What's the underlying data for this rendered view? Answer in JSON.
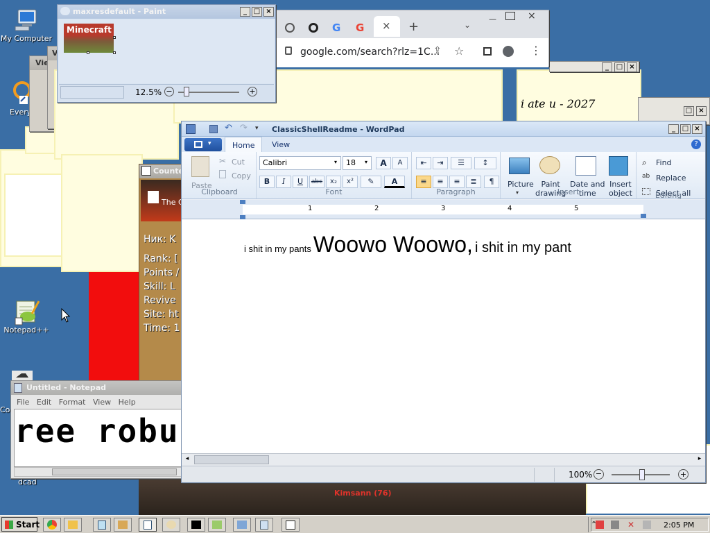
{
  "desktop": {
    "icons": [
      {
        "label": "My Computer"
      },
      {
        "label": "Every"
      },
      {
        "label": "Notepad++"
      },
      {
        "label": "Co"
      },
      {
        "label": "dcad"
      }
    ]
  },
  "paint": {
    "title": "maxresdefault - Paint",
    "image_text": "Minecraft",
    "zoom": "12.5%"
  },
  "chrome": {
    "url": "google.com/search?rlz=1C..."
  },
  "ghost_text": "i ate u - 2027",
  "counter": {
    "title": "Counte",
    "banner_text": "The C",
    "lines": [
      "Ник: K",
      "Rank: [",
      "Points /",
      "Skill: L",
      "Revive",
      "Site: ht",
      "Time: 1"
    ]
  },
  "game_text": "Kimsann (76)",
  "notepad": {
    "title": "Untitled - Notepad",
    "menu": [
      "File",
      "Edit",
      "Format",
      "View",
      "Help"
    ],
    "content": "ree robu"
  },
  "wordpad": {
    "title": "ClassicShellReadme - WordPad",
    "tabs": {
      "home": "Home",
      "view": "View"
    },
    "clipboard": {
      "paste": "Paste",
      "cut": "Cut",
      "copy": "Copy",
      "label": "Clipboard"
    },
    "font": {
      "family": "Calibri",
      "size": "18",
      "label": "Font",
      "bold": "B",
      "italic": "I",
      "underline": "U",
      "strike": "abc",
      "subscript": "x₂",
      "superscript": "x²",
      "grow": "A",
      "shrink": "A",
      "color": "A"
    },
    "paragraph": {
      "label": "Paragraph"
    },
    "insert": {
      "picture": "Picture",
      "paint_drawing": [
        "Paint",
        "drawing"
      ],
      "date_time": [
        "Date and",
        "time"
      ],
      "insert_object": [
        "Insert",
        "object"
      ],
      "label": "Insert"
    },
    "editing": {
      "find": "Find",
      "replace": "Replace",
      "select_all": "Select all",
      "label": "Editing"
    },
    "ruler_numbers": [
      "1",
      "2",
      "3",
      "4",
      "5"
    ],
    "doc": {
      "small1": "i shit in my pants",
      "big": "Woowo Woowo,",
      "medium": "i shit in my pant"
    },
    "zoom": "100%"
  },
  "taskbar": {
    "start": "Start",
    "clock": "2:05 PM"
  },
  "colors": {
    "desktop": "#3a6ea5",
    "titlebar": "#a8c4e8",
    "ribbon": "#dfe9f5",
    "red_panel": "#f20d0d"
  }
}
